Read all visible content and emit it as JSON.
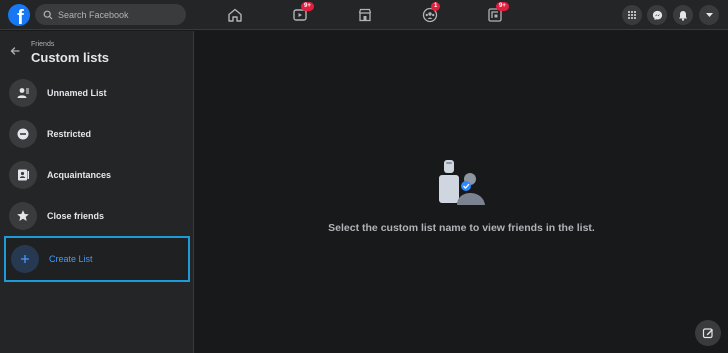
{
  "topbar": {
    "logo": "f",
    "search_placeholder": "Search Facebook",
    "nav": [
      {
        "icon": "home-icon",
        "badge": ""
      },
      {
        "icon": "watch-icon",
        "badge": "9+"
      },
      {
        "icon": "marketplace-icon",
        "badge": ""
      },
      {
        "icon": "groups-icon",
        "badge": "1"
      },
      {
        "icon": "gaming-icon",
        "badge": "9+"
      }
    ],
    "right": [
      "menu-grid-icon",
      "messenger-icon",
      "notifications-icon",
      "account-dropdown-icon"
    ]
  },
  "sidebar": {
    "breadcrumb": "Friends",
    "title": "Custom lists",
    "items": [
      {
        "label": "Unnamed List",
        "icon": "person-list-icon"
      },
      {
        "label": "Restricted",
        "icon": "minus-circle-icon"
      },
      {
        "label": "Acquaintances",
        "icon": "contact-card-icon"
      },
      {
        "label": "Close friends",
        "icon": "star-icon"
      },
      {
        "label": "Create List",
        "icon": "plus-icon"
      }
    ]
  },
  "main": {
    "message": "Select the custom list name to view friends in the list."
  },
  "colors": {
    "accent": "#1877f2",
    "badge": "#e41e3f",
    "highlight": "#1c9bd8",
    "link": "#4599ff"
  }
}
